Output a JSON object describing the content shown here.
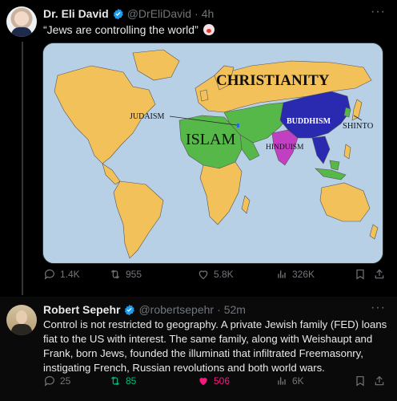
{
  "tweet1": {
    "author_name": "Dr. Eli David",
    "handle": "@DrEliDavid",
    "time": "4h",
    "text": "“Jews are controlling the world”",
    "map_labels": {
      "christianity": "CHRISTIANITY",
      "judaism": "JUDAISM",
      "islam": "ISLAM",
      "buddhism": "BUDDHISM",
      "shinto": "SHINTO",
      "hinduism": "HINDUISM"
    },
    "stats": {
      "replies": "1.4K",
      "reposts": "955",
      "likes": "5.8K",
      "views": "326K"
    }
  },
  "tweet2": {
    "author_name": "Robert Sepehr",
    "handle": "@robertsepehr",
    "time": "52m",
    "text": "Control is not restricted to geography. A private Jewish family (FED) loans fiat to the US with interest. The same family, along with Weishaupt and Frank, born Jews, founded the illuminati that infiltrated Freemasonry, instigating French, Russian revolutions and both world wars.",
    "stats": {
      "replies": "25",
      "reposts": "85",
      "likes": "506",
      "views": "6K"
    }
  },
  "icons": [
    "verified-badge-icon",
    "more-icon",
    "reply-icon",
    "repost-icon",
    "like-icon",
    "views-icon",
    "bookmark-icon",
    "share-icon",
    "clown-emoji-icon"
  ],
  "colors": {
    "background": "#000000",
    "text": "#e7e9ea",
    "muted": "#71767b",
    "verified": "#1d9bf0",
    "repost_active": "#00ba7c",
    "like_active": "#f91880",
    "map_christianity": "#f3c15a",
    "map_islam": "#57b84a",
    "map_buddhism": "#2a2ab0",
    "map_hinduism": "#c13fc1",
    "map_ocean": "#b8d0e6"
  }
}
